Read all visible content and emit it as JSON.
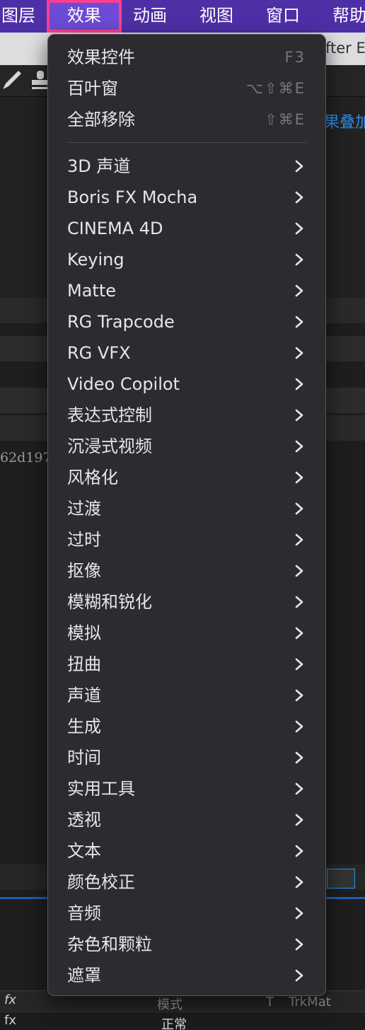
{
  "menubar": {
    "items": [
      {
        "label": "图层"
      },
      {
        "label": "效果"
      },
      {
        "label": "动画"
      },
      {
        "label": "视图"
      },
      {
        "label": "窗口"
      },
      {
        "label": "帮助"
      }
    ],
    "colors": {
      "bar": "#4f2fa6",
      "highlight_border": "#ff3f93"
    }
  },
  "background": {
    "title_fragment": "fter E",
    "blue_text": "果叠加",
    "hash_fragment": "62d197",
    "bottom_labels": {
      "mode": "模式",
      "t": "T",
      "trkmat": "TrkMat",
      "normal": "正常"
    }
  },
  "effects_menu": {
    "top_items": [
      {
        "label": "效果控件",
        "shortcut": "F3"
      },
      {
        "label": "百叶窗",
        "shortcut": "⌥⇧⌘E"
      },
      {
        "label": "全部移除",
        "shortcut": "⇧⌘E"
      }
    ],
    "submenus": [
      {
        "label": "3D 声道"
      },
      {
        "label": "Boris FX Mocha"
      },
      {
        "label": "CINEMA 4D"
      },
      {
        "label": "Keying"
      },
      {
        "label": "Matte"
      },
      {
        "label": "RG Trapcode"
      },
      {
        "label": "RG VFX"
      },
      {
        "label": "Video Copilot"
      },
      {
        "label": "表达式控制"
      },
      {
        "label": "沉浸式视频"
      },
      {
        "label": "风格化"
      },
      {
        "label": "过渡"
      },
      {
        "label": "过时"
      },
      {
        "label": "抠像"
      },
      {
        "label": "模糊和锐化"
      },
      {
        "label": "模拟"
      },
      {
        "label": "扭曲"
      },
      {
        "label": "声道"
      },
      {
        "label": "生成"
      },
      {
        "label": "时间"
      },
      {
        "label": "实用工具"
      },
      {
        "label": "透视"
      },
      {
        "label": "文本"
      },
      {
        "label": "颜色校正"
      },
      {
        "label": "音频"
      },
      {
        "label": "杂色和颗粒"
      },
      {
        "label": "遮罩"
      }
    ],
    "chevron_icon": "chevron-right-icon"
  }
}
